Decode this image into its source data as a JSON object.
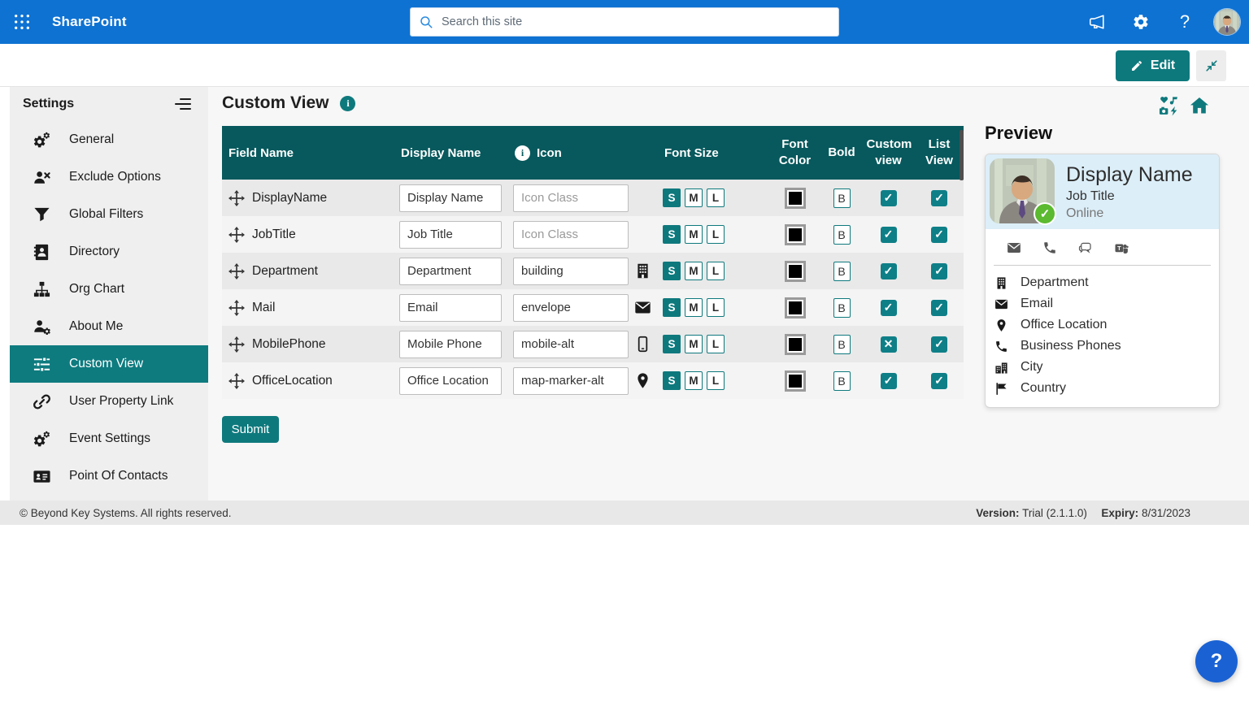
{
  "colors": {
    "suite_bar_blue": "#0E72D2",
    "accent_teal": "#0E797D",
    "table_header_teal": "#07595D",
    "checkbox_teal": "#0E7F87",
    "selected_nav_teal": "#0E7B7F",
    "preview_header_blue": "#DCEEF8",
    "presence_green": "#5BBA2F",
    "help_button_blue": "#1A62D4",
    "font_color_swatch": "#000000"
  },
  "suite_bar": {
    "app_name": "SharePoint",
    "search_placeholder": "Search this site"
  },
  "command_bar": {
    "edit_label": "Edit"
  },
  "sidebar": {
    "title": "Settings",
    "items": [
      {
        "label": "General",
        "icon": "gears-icon"
      },
      {
        "label": "Exclude Options",
        "icon": "user-x-icon"
      },
      {
        "label": "Global Filters",
        "icon": "filter-icon"
      },
      {
        "label": "Directory",
        "icon": "address-book-icon"
      },
      {
        "label": "Org Chart",
        "icon": "sitemap-icon"
      },
      {
        "label": "About Me",
        "icon": "user-gear-icon"
      },
      {
        "label": "Custom View",
        "icon": "sliders-icon",
        "selected": true
      },
      {
        "label": "User Property Link",
        "icon": "link-icon"
      },
      {
        "label": "Event Settings",
        "icon": "gears-icon"
      },
      {
        "label": "Point Of Contacts",
        "icon": "id-card-icon"
      }
    ]
  },
  "main": {
    "title": "Custom View",
    "corner_icons": [
      "icon-pack-icon",
      "home-icon"
    ],
    "table": {
      "headers": [
        "Field Name",
        "Display Name",
        "Icon",
        "Font Size",
        "Font Color",
        "Bold",
        "Custom view",
        "List View"
      ],
      "font_sizes": [
        "S",
        "M",
        "L"
      ],
      "bold_label": "B",
      "icon_placeholder": "Icon Class",
      "rows": [
        {
          "field_name": "DisplayName",
          "display_name": "Display Name",
          "icon_class": "",
          "row_icon": "",
          "font_size_selected": "S",
          "custom_view": "✓",
          "list_view": "✓"
        },
        {
          "field_name": "JobTitle",
          "display_name": "Job Title",
          "icon_class": "",
          "row_icon": "",
          "font_size_selected": "S",
          "custom_view": "✓",
          "list_view": "✓"
        },
        {
          "field_name": "Department",
          "display_name": "Department",
          "icon_class": "building",
          "row_icon": "building-icon",
          "font_size_selected": "S",
          "custom_view": "✓",
          "list_view": "✓"
        },
        {
          "field_name": "Mail",
          "display_name": "Email",
          "icon_class": "envelope",
          "row_icon": "envelope-icon",
          "font_size_selected": "S",
          "custom_view": "✓",
          "list_view": "✓"
        },
        {
          "field_name": "MobilePhone",
          "display_name": "Mobile Phone",
          "icon_class": "mobile-alt",
          "row_icon": "mobile-icon",
          "font_size_selected": "S",
          "custom_view": "✕",
          "list_view": "✓"
        },
        {
          "field_name": "OfficeLocation",
          "display_name": "Office Location",
          "icon_class": "map-marker-alt",
          "row_icon": "map-marker-icon",
          "font_size_selected": "S",
          "custom_view": "✓",
          "list_view": "✓"
        }
      ]
    },
    "submit_label": "Submit"
  },
  "preview": {
    "title": "Preview",
    "card": {
      "display_name": "Display Name",
      "job_title": "Job Title",
      "presence": "Online",
      "action_icons": [
        "envelope-icon",
        "phone-icon",
        "chat-icon",
        "teams-icon"
      ],
      "fields": [
        {
          "icon": "building-icon",
          "label": "Department"
        },
        {
          "icon": "envelope-icon",
          "label": "Email"
        },
        {
          "icon": "map-marker-icon",
          "label": "Office Location"
        },
        {
          "icon": "phone-icon",
          "label": "Business Phones"
        },
        {
          "icon": "city-icon",
          "label": "City"
        },
        {
          "icon": "flag-icon",
          "label": "Country"
        }
      ]
    }
  },
  "footer": {
    "copyright": "© Beyond Key Systems. All rights reserved.",
    "version_label": "Version:",
    "version_value": "Trial (2.1.1.0)",
    "expiry_label": "Expiry:",
    "expiry_value": "8/31/2023"
  },
  "help_button": {
    "label": "?"
  }
}
